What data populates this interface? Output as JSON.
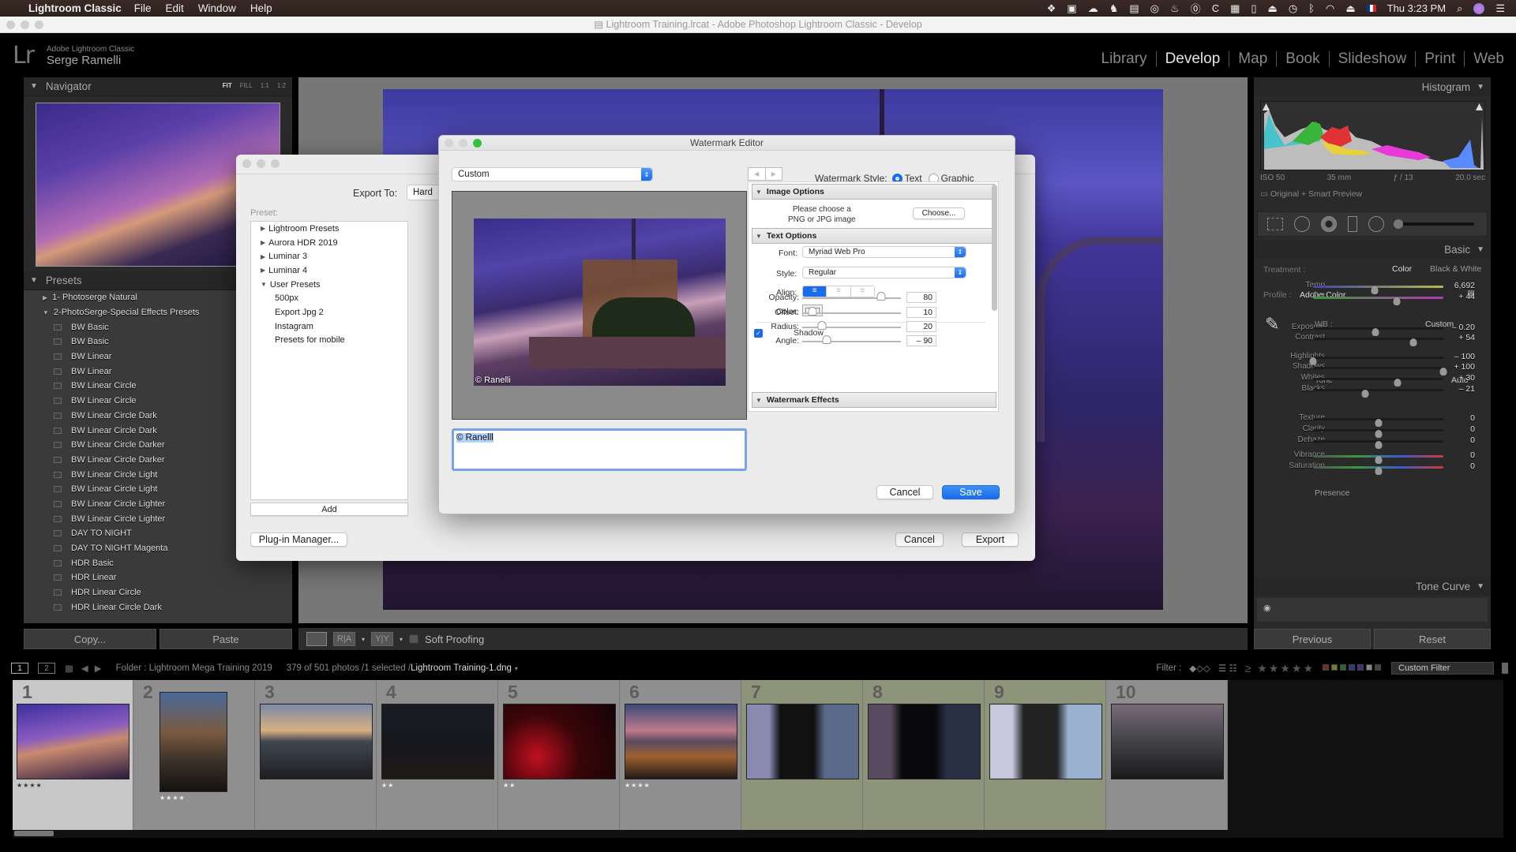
{
  "menubar": {
    "app": "Lightroom Classic",
    "items": [
      "File",
      "Edit",
      "Window",
      "Help"
    ],
    "clock": "Thu 3:23 PM",
    "tray_icons": [
      "dropbox-icon",
      "facetime-icon",
      "cloud-upload-icon",
      "evernote-icon",
      "screen-record-icon",
      "creative-cloud-icon",
      "flame-icon",
      "onepassword-icon",
      "cc-icon",
      "folder-icon",
      "phone-icon",
      "airplay-icon",
      "time-machine-icon",
      "bluetooth-icon",
      "wifi-icon",
      "eject-icon",
      "flag-fr-icon"
    ]
  },
  "window": {
    "title": "Lightroom Training.lrcat - Adobe Photoshop Lightroom Classic - Develop"
  },
  "identity": {
    "logo": "Lr",
    "product": "Adobe Lightroom Classic",
    "user": "Serge Ramelli"
  },
  "modules": [
    {
      "label": "Library",
      "active": false
    },
    {
      "label": "Develop",
      "active": true
    },
    {
      "label": "Map",
      "active": false
    },
    {
      "label": "Book",
      "active": false
    },
    {
      "label": "Slideshow",
      "active": false
    },
    {
      "label": "Print",
      "active": false
    },
    {
      "label": "Web",
      "active": false
    }
  ],
  "navigator": {
    "title": "Navigator",
    "zoom_options": [
      "FIT",
      "FILL",
      "1:1",
      "1:2"
    ],
    "active_zoom": "FIT"
  },
  "presets": {
    "title": "Presets",
    "groups": [
      {
        "label": "1- Photoserge Natural",
        "expanded": false
      },
      {
        "label": "2-PhotoSerge-Special Effects Presets",
        "expanded": true
      }
    ],
    "items": [
      "BW Basic",
      "BW Basic",
      "BW Linear",
      "BW Linear",
      "BW Linear Circle",
      "BW Linear Circle",
      "BW Linear Circle Dark",
      "BW Linear Circle Dark",
      "BW Linear Circle Darker",
      "BW Linear Circle Darker",
      "BW Linear Circle Light",
      "BW Linear Circle Light",
      "BW Linear Circle Lighter",
      "BW Linear Circle Lighter",
      "DAY TO NIGHT",
      "DAY TO NIGHT Magenta",
      "HDR Basic",
      "HDR Linear",
      "HDR Linear Circle",
      "HDR Linear Circle Dark"
    ]
  },
  "left_buttons": {
    "copy": "Copy...",
    "paste": "Paste"
  },
  "toolbar": {
    "soft_proofing": "Soft Proofing",
    "before_after_1": "R|A",
    "before_after_2": "Y|Y"
  },
  "right_panel": {
    "histogram_title": "Histogram",
    "meta": {
      "iso": "ISO 50",
      "focal": "35 mm",
      "aperture": "ƒ / 13",
      "shutter": "20.0 sec"
    },
    "preview_status": "Original + Smart Preview",
    "basic_title": "Basic",
    "treatment_label": "Treatment :",
    "treatment_color": "Color",
    "treatment_bw": "Black & White",
    "profile_label": "Profile :",
    "profile_value": "Adobe Color",
    "wb_label": "WB :",
    "wb_value": "Custom",
    "tone_label": "Tone",
    "auto_label": "Auto",
    "presence_label": "Presence",
    "tone_curve_title": "Tone Curve",
    "sliders": [
      {
        "name": "Temp",
        "value": "6,692",
        "pos": 0.47
      },
      {
        "name": "Tint",
        "value": "+ 44",
        "pos": 0.64
      },
      {
        "name": "Exposure",
        "value": "– 0.20",
        "pos": 0.48
      },
      {
        "name": "Contrast",
        "value": "+ 54",
        "pos": 0.77
      },
      {
        "name": "Highlights",
        "value": "– 100",
        "pos": 0.0
      },
      {
        "name": "Shadows",
        "value": "+ 100",
        "pos": 1.0
      },
      {
        "name": "Whites",
        "value": "+ 30",
        "pos": 0.65
      },
      {
        "name": "Blacks",
        "value": "– 21",
        "pos": 0.4
      },
      {
        "name": "Texture",
        "value": "0",
        "pos": 0.5
      },
      {
        "name": "Clarity",
        "value": "0",
        "pos": 0.5
      },
      {
        "name": "Dehaze",
        "value": "0",
        "pos": 0.5
      },
      {
        "name": "Vibrance",
        "value": "0",
        "pos": 0.5
      },
      {
        "name": "Saturation",
        "value": "0",
        "pos": 0.5
      }
    ]
  },
  "right_buttons": {
    "previous": "Previous",
    "reset": "Reset"
  },
  "filmstrip_bar": {
    "page1": "1",
    "page2": "2",
    "folder": "Folder : Lightroom Mega Training 2019",
    "count": "379 of 501 photos /1 selected /",
    "filename": "Lightroom Training-1.dng",
    "filter_label": "Filter :",
    "custom_filter": "Custom Filter"
  },
  "filmstrip": [
    {
      "num": "1",
      "stars": "★★★★",
      "state": "selected"
    },
    {
      "num": "2",
      "stars": "★★★★",
      "state": "normal"
    },
    {
      "num": "3",
      "stars": "",
      "state": "normal"
    },
    {
      "num": "4",
      "stars": "★★",
      "state": "normal"
    },
    {
      "num": "5",
      "stars": "★★",
      "state": "normal"
    },
    {
      "num": "6",
      "stars": "★★★★",
      "state": "normal"
    },
    {
      "num": "7",
      "stars": "",
      "state": "green"
    },
    {
      "num": "8",
      "stars": "",
      "state": "green"
    },
    {
      "num": "9",
      "stars": "",
      "state": "green"
    },
    {
      "num": "10",
      "stars": "",
      "state": "normal"
    }
  ],
  "export_dialog": {
    "export_to_label": "Export To:",
    "export_to_value": "Hard",
    "preset_label": "Preset:",
    "tree": [
      {
        "label": "Lightroom Presets",
        "type": "group",
        "expanded": false
      },
      {
        "label": "Aurora HDR 2019",
        "type": "group",
        "expanded": false
      },
      {
        "label": "Luminar 3",
        "type": "group",
        "expanded": false
      },
      {
        "label": "Luminar 4",
        "type": "group",
        "expanded": false
      },
      {
        "label": "User Presets",
        "type": "group",
        "expanded": true
      },
      {
        "label": "500px",
        "type": "child"
      },
      {
        "label": "Export Jpg 2",
        "type": "child"
      },
      {
        "label": "Instagram",
        "type": "child"
      },
      {
        "label": "Presets for mobile",
        "type": "child"
      }
    ],
    "add": "Add",
    "plugin_manager": "Plug-in Manager...",
    "cancel": "Cancel",
    "export": "Export"
  },
  "watermark_editor": {
    "title": "Watermark Editor",
    "preset_select": "Custom",
    "style_label": "Watermark Style:",
    "style_text": "Text",
    "style_graphic": "Graphic",
    "style_selected": "Text",
    "watermark_text_prefix": "© Rane",
    "watermark_text_rest": "lli",
    "preview_watermark": "© Ranelli",
    "image_options": {
      "title": "Image Options",
      "hint_line1": "Please choose a",
      "hint_line2": "PNG or JPG image",
      "choose": "Choose..."
    },
    "text_options": {
      "title": "Text Options",
      "font_label": "Font:",
      "font_value": "Myriad Web Pro",
      "style_label": "Style:",
      "style_value": "Regular",
      "align_label": "Align:",
      "align_selected": "left",
      "color_label": "Color:",
      "color_value": "#ffffff"
    },
    "shadow": {
      "label": "Shadow",
      "enabled": true,
      "opacity_label": "Opacity:",
      "opacity": "80",
      "opacity_pos": 0.8,
      "offset_label": "Offset:",
      "offset": "10",
      "offset_pos": 0.1,
      "radius_label": "Radius:",
      "radius": "20",
      "radius_pos": 0.2,
      "angle_label": "Angle:",
      "angle": "– 90",
      "angle_pos": 0.25
    },
    "effects_title": "Watermark Effects",
    "cancel": "Cancel",
    "save": "Save"
  },
  "colors": {
    "accent_blue": "#1a6de8",
    "selected_green": "#2fc23a",
    "lr_bg": "#2a2a2a"
  }
}
